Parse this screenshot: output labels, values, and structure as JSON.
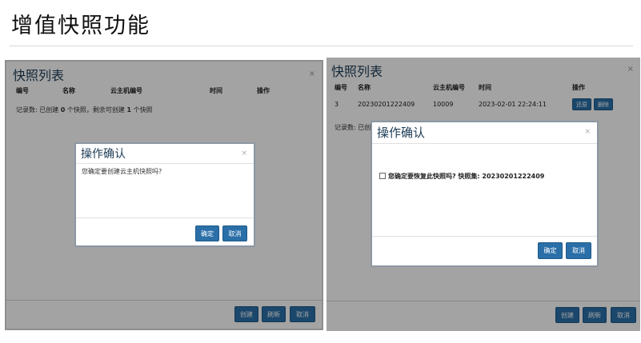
{
  "slide": {
    "title": "增值快照功能"
  },
  "left_panel": {
    "title": "快照列表",
    "close": "×",
    "columns": [
      "编号",
      "名称",
      "云主机编号",
      "时间",
      "操作"
    ],
    "record_prefix": "记录数: 已创建",
    "record_created": "0",
    "record_middle": "个快照，剩余可创建",
    "record_remaining": "1",
    "record_suffix": "个快照",
    "buttons": {
      "create": "创建",
      "refresh": "刷新",
      "cancel": "取消"
    },
    "dialog": {
      "title": "操作确认",
      "close": "×",
      "message": "您确定要创建云主机快照吗?",
      "ok": "确定",
      "cancel": "取消"
    }
  },
  "right_panel": {
    "title": "快照列表",
    "close": "×",
    "columns": [
      "编号",
      "名称",
      "云主机编号",
      "时间",
      "操作"
    ],
    "row": {
      "id": "3",
      "name": "20230201222409",
      "host_id": "10009",
      "time": "2023-02-01 22:24:11",
      "restore": "还原",
      "delete": "删除"
    },
    "record_prefix": "记录数: 已创",
    "buttons": {
      "create": "创建",
      "refresh": "刷新",
      "cancel": "取消"
    },
    "dialog": {
      "title": "操作确认",
      "close": "×",
      "message": "您确定要恢复此快照吗? 快照集: 20230201222409",
      "ok": "确定",
      "cancel": "取消"
    }
  }
}
